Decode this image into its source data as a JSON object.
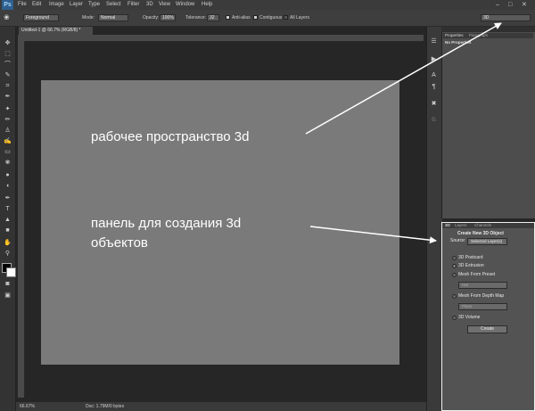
{
  "app": {
    "logo": "Ps"
  },
  "menu": [
    "File",
    "Edit",
    "Image",
    "Layer",
    "Type",
    "Select",
    "Filter",
    "3D",
    "View",
    "Window",
    "Help"
  ],
  "options_bar": {
    "fill_source": "Foreground",
    "mode_label": "Mode:",
    "mode_value": "Normal",
    "opacity_label": "Opacity:",
    "opacity_value": "100%",
    "tolerance_label": "Tolerance:",
    "tolerance_value": "32",
    "antialias_label": "Anti-alias",
    "antialias_checked": true,
    "contiguous_label": "Contiguous",
    "contiguous_checked": true,
    "all_layers_label": "All Layers",
    "all_layers_checked": false,
    "workspace_value": "3D"
  },
  "document": {
    "tab_title": "Untitled-1 @ 66.7% (RGB/8) *",
    "zoom": "66.67%",
    "doc_info": "Doc: 1.79M/0 bytes"
  },
  "properties_panel": {
    "tabs": [
      "Properties",
      "Paragraph"
    ],
    "heading": "No Properties"
  },
  "panel_3d": {
    "tabs": [
      "3D",
      "Layers",
      "Channels"
    ],
    "title": "Create New 3D Object",
    "source_label": "Source:",
    "source_value": "Selected Layer(s)",
    "options": [
      "3D Postcard",
      "3D Extrusion",
      "Mesh From Preset",
      "Mesh From Depth Map",
      "3D Volume"
    ],
    "selected_option": "3D Extrusion",
    "preset_value": "Hat",
    "depth_map_value": "Plane",
    "create_button": "Create"
  },
  "annotations": {
    "workspace": "рабочее пространство 3d",
    "panel_line1": "панель для создания 3d",
    "panel_line2": "объектов"
  },
  "colors": {
    "canvas": "#7a7a7a",
    "workspace_bg": "#262626",
    "annotation": "#ffffff"
  }
}
